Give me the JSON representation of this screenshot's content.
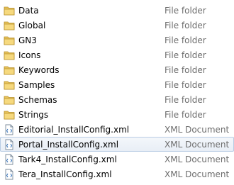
{
  "files": [
    {
      "name": "Data",
      "type": "File folder",
      "icon": "folder-icon"
    },
    {
      "name": "Global",
      "type": "File folder",
      "icon": "folder-icon"
    },
    {
      "name": "GN3",
      "type": "File folder",
      "icon": "folder-icon"
    },
    {
      "name": "Icons",
      "type": "File folder",
      "icon": "folder-icon"
    },
    {
      "name": "Keywords",
      "type": "File folder",
      "icon": "folder-icon"
    },
    {
      "name": "Samples",
      "type": "File folder",
      "icon": "folder-icon"
    },
    {
      "name": "Schemas",
      "type": "File folder",
      "icon": "folder-icon"
    },
    {
      "name": "Strings",
      "type": "File folder",
      "icon": "folder-icon"
    },
    {
      "name": "Editorial_InstallConfig.xml",
      "type": "XML Document",
      "icon": "xml-document-icon"
    },
    {
      "name": "Portal_InstallConfig.xml",
      "type": "XML Document",
      "icon": "xml-document-icon",
      "selected": true
    },
    {
      "name": "Tark4_InstallConfig.xml",
      "type": "XML Document",
      "icon": "xml-document-icon"
    },
    {
      "name": "Tera_InstallConfig.xml",
      "type": "XML Document",
      "icon": "xml-document-icon"
    }
  ],
  "colors": {
    "folder": "#e8c35c",
    "selection_border": "#b8cce4",
    "type_text": "#6d6d6d"
  }
}
